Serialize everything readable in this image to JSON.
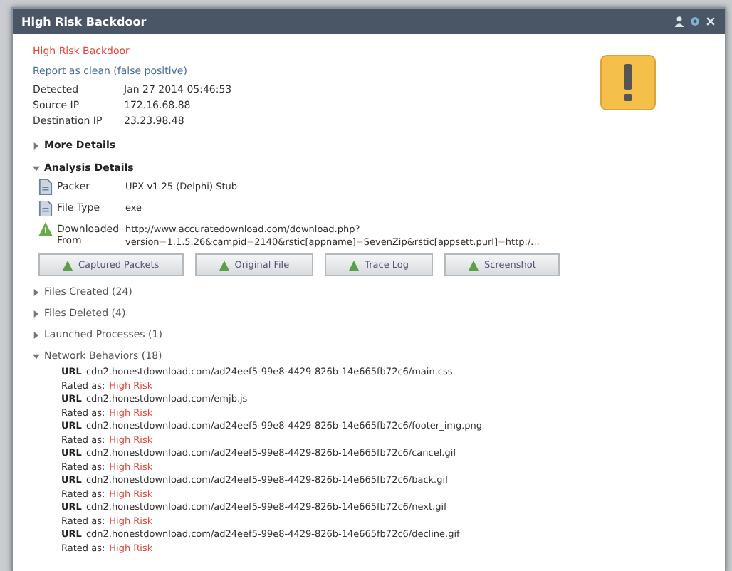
{
  "window": {
    "title": "High Risk Backdoor"
  },
  "summary": {
    "threat": "High Risk Backdoor",
    "report_link": "Report as clean (false positive)",
    "fields": [
      {
        "label": "Detected",
        "value": "Jan 27 2014 05:46:53"
      },
      {
        "label": "Source IP",
        "value": "172.16.68.88"
      },
      {
        "label": "Destination IP",
        "value": "23.23.98.48"
      }
    ]
  },
  "sections": [
    {
      "label": "More Details",
      "expanded": false
    },
    {
      "label": "Analysis Details",
      "expanded": true
    }
  ],
  "analysis": [
    {
      "kind": "file",
      "label": "Packer",
      "lines": [
        "UPX v1.25 (Delphi) Stub"
      ]
    },
    {
      "kind": "file",
      "label": "File Type",
      "lines": [
        "exe"
      ]
    },
    {
      "kind": "download",
      "label": "Downloaded From",
      "lines": [
        "http://www.accuratedownload.com/download.php?",
        "version=1.1.5.26&campid=2140&rstic[appname]=SevenZip&rstic[appsett.purl]=http:/..."
      ]
    }
  ],
  "buttons": [
    "Captured Packets",
    "Original File",
    "Trace Log",
    "Screenshot"
  ],
  "groups": [
    {
      "label": "Files Created (24)",
      "expanded": false
    },
    {
      "label": "Files Deleted (4)",
      "expanded": false
    },
    {
      "label": "Launched Processes (1)",
      "expanded": false
    },
    {
      "label": "Network Behaviors (18)",
      "expanded": true
    }
  ],
  "network": [
    {
      "url_label": "URL",
      "url": "cdn2.honestdownload.com/ad24eef5-99e8-4429-826b-14e665fb72c6/main.css",
      "rating_label": "Rated as:",
      "rating": "High Risk"
    },
    {
      "url_label": "URL",
      "url": "cdn2.honestdownload.com/emjb.js",
      "rating_label": "Rated as:",
      "rating": "High Risk"
    },
    {
      "url_label": "URL",
      "url": "cdn2.honestdownload.com/ad24eef5-99e8-4429-826b-14e665fb72c6/footer_img.png",
      "rating_label": "Rated as:",
      "rating": "High Risk"
    },
    {
      "url_label": "URL",
      "url": "cdn2.honestdownload.com/ad24eef5-99e8-4429-826b-14e665fb72c6/cancel.gif",
      "rating_label": "Rated as:",
      "rating": "High Risk"
    },
    {
      "url_label": "URL",
      "url": "cdn2.honestdownload.com/ad24eef5-99e8-4429-826b-14e665fb72c6/back.gif",
      "rating_label": "Rated as:",
      "rating": "High Risk"
    },
    {
      "url_label": "URL",
      "url": "cdn2.honestdownload.com/ad24eef5-99e8-4429-826b-14e665fb72c6/next.gif",
      "rating_label": "Rated as:",
      "rating": "High Risk"
    },
    {
      "url_label": "URL",
      "url": "cdn2.honestdownload.com/ad24eef5-99e8-4429-826b-14e665fb72c6/decline.gif",
      "rating_label": "Rated as:",
      "rating": "High Risk"
    }
  ]
}
